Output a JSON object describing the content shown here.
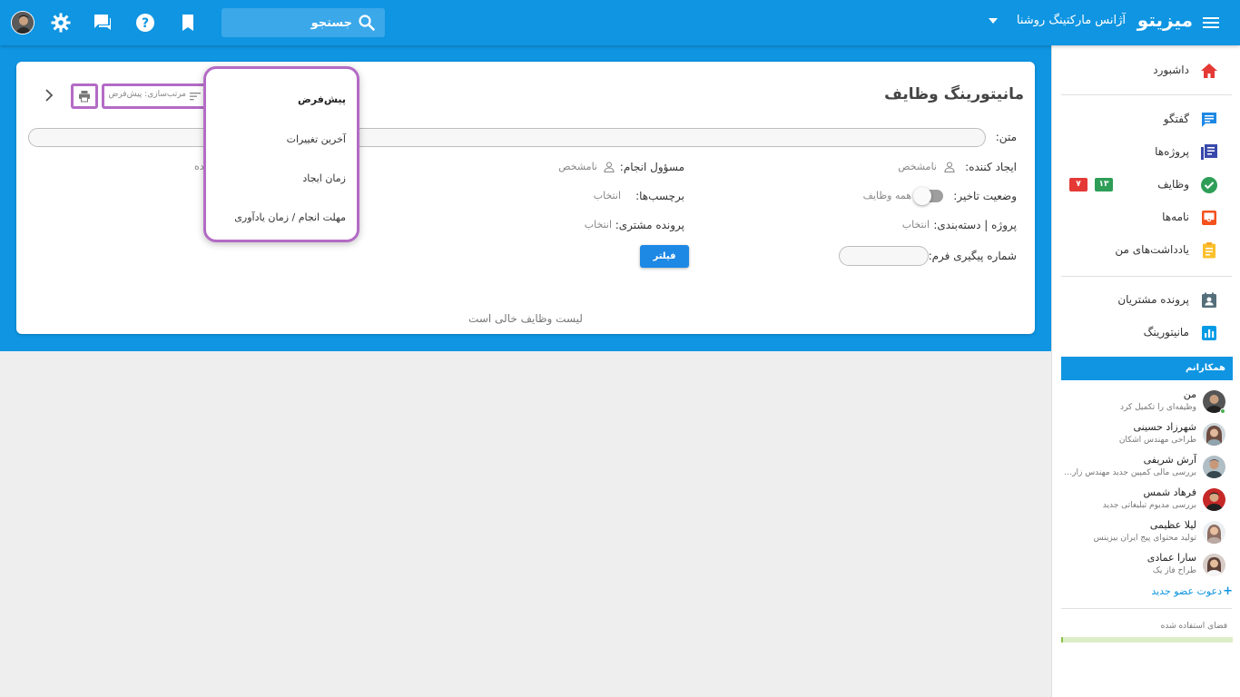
{
  "topbar": {
    "brand": "میزیتو",
    "agency": "آژانس مارکتینگ روشنا",
    "search_placeholder": "جستجو"
  },
  "page": {
    "title": "مانیتورینگ وظایف",
    "sort_label": "مرتب‌سازی: پیش‌فرض",
    "empty_message": "لیست وظایف خالی است"
  },
  "filters": {
    "text_label": "متن:",
    "creator_label": "ایجاد کننده:",
    "creator_value": "نامشخص",
    "assignee_label": "مسؤول انجام:",
    "assignee_value": "نامشخص",
    "third_value": "ده",
    "delay_label": "وضعیت تاخیر:",
    "delay_value": "همه وظایف",
    "tags_label": "برچسب‌ها:",
    "tags_value": "انتخاب",
    "project_label": "پروژه | دسته‌بندی:",
    "project_value": "انتخاب",
    "customer_label": "پرونده مشتری:",
    "customer_value": "انتخاب",
    "tracking_label": "شماره پیگیری فرم:",
    "filter_button": "فیلتر"
  },
  "sort_menu": {
    "items": [
      {
        "label": "پیش‌فرض",
        "active": true
      },
      {
        "label": "آخرین تغییرات",
        "active": false
      },
      {
        "label": "زمان ایجاد",
        "active": false
      },
      {
        "label": "مهلت انجام / زمان یادآوری",
        "active": false
      }
    ]
  },
  "sidebar": {
    "items": [
      {
        "label": "داشبورد",
        "icon": "home-icon"
      },
      {
        "label": "گفتگو",
        "icon": "chat-icon"
      },
      {
        "label": "پروژه‌ها",
        "icon": "projects-icon"
      },
      {
        "label": "وظایف",
        "icon": "tasks-icon",
        "badge_green": "۱۳",
        "badge_red": "۷"
      },
      {
        "label": "نامه‌ها",
        "icon": "inbox-icon"
      },
      {
        "label": "یادداشت‌های من",
        "icon": "notes-icon"
      },
      {
        "label": "پرونده مشتریان",
        "icon": "customers-icon"
      },
      {
        "label": "مانیتورینگ",
        "icon": "monitoring-icon"
      }
    ],
    "team_header": "همکارانم",
    "members": [
      {
        "name": "من",
        "task": "وظیفه‌ای را تکمیل کرد"
      },
      {
        "name": "شهرزاد حسینی",
        "task": "طراحی مهندس اشکان"
      },
      {
        "name": "آرش شریفی",
        "task": "بررسی مالی کمپین جدید مهندس زارعی"
      },
      {
        "name": "فرهاد شمس",
        "task": "بررسی مدیوم تبلیغاتی جدید"
      },
      {
        "name": "لیلا عظیمی",
        "task": "تولید محتوای پیج ایران بیزینس"
      },
      {
        "name": "سارا عمادی",
        "task": "طراح فاز یک"
      }
    ],
    "invite_label": "دعوت عضو جدید",
    "storage_label": "فضای استفاده شده",
    "storage_used_fraction": 0.01
  },
  "colors": {
    "primary": "#0f95e2",
    "highlight": "#b36bc5",
    "badge_green": "#2e9e57",
    "badge_red": "#e53935"
  }
}
